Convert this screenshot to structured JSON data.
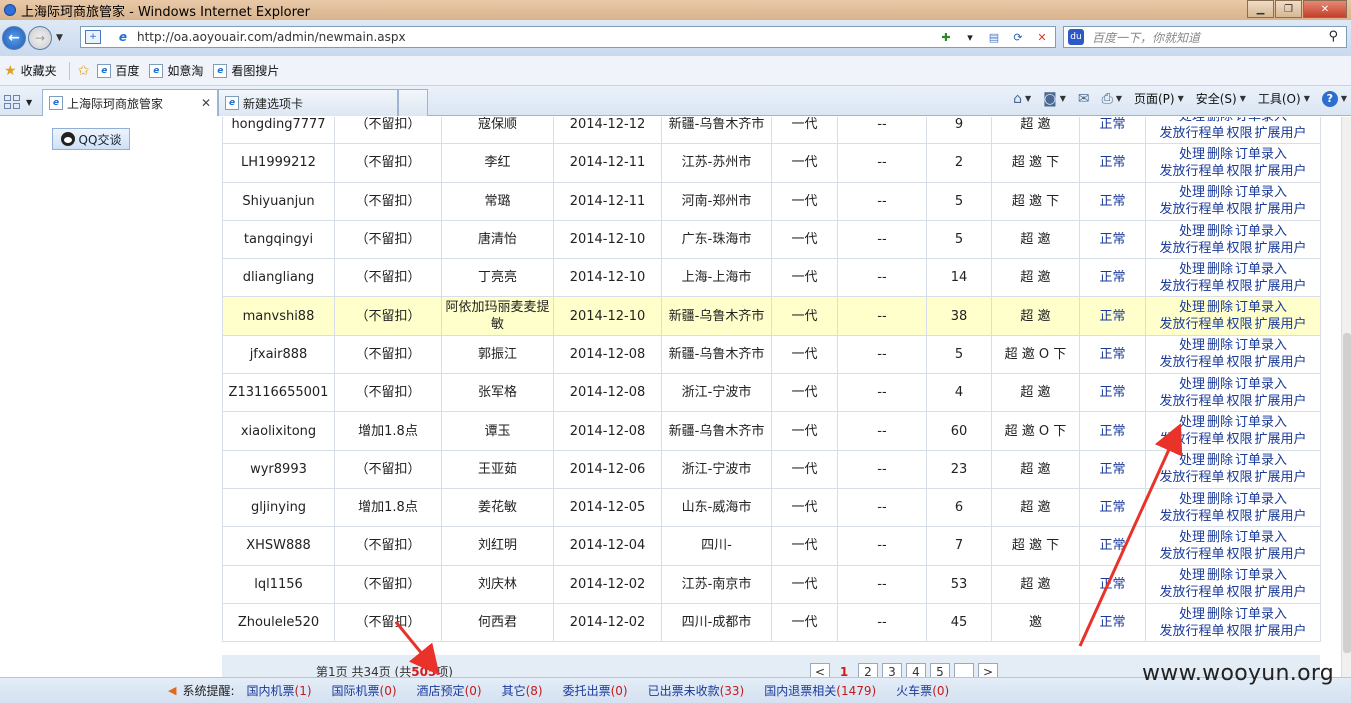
{
  "window": {
    "title": "上海际珂商旅管家 - Windows Internet Explorer"
  },
  "address": {
    "url": "http://oa.aoyouair.com/admin/newmain.aspx",
    "search_placeholder": "百度一下，你就知道"
  },
  "favorites": {
    "label": "收藏夹",
    "items": [
      "百度",
      "如意淘",
      "看图搜片"
    ]
  },
  "tabs": [
    {
      "label": "上海际珂商旅管家"
    },
    {
      "label": "新建选项卡"
    }
  ],
  "commands": {
    "page": "页面(P)",
    "safety": "安全(S)",
    "tools": "工具(O)"
  },
  "sidebar": {
    "qq_label": "QQ交谈"
  },
  "table": {
    "rows": [
      [
        "hongding7777",
        "（不留扣）",
        "寇保顺",
        "2014-12-12",
        "新疆-乌鲁木齐市",
        "一代",
        "--",
        "9",
        "超 邀",
        "正常"
      ],
      [
        "LH1999212",
        "（不留扣）",
        "李红",
        "2014-12-11",
        "江苏-苏州市",
        "一代",
        "--",
        "2",
        "超 邀 下",
        "正常"
      ],
      [
        "Shiyuanjun",
        "（不留扣）",
        "常璐",
        "2014-12-11",
        "河南-郑州市",
        "一代",
        "--",
        "5",
        "超 邀 下",
        "正常"
      ],
      [
        "tangqingyi",
        "（不留扣）",
        "唐清怡",
        "2014-12-10",
        "广东-珠海市",
        "一代",
        "--",
        "5",
        "超 邀",
        "正常"
      ],
      [
        "dliangliang",
        "（不留扣）",
        "丁亮亮",
        "2014-12-10",
        "上海-上海市",
        "一代",
        "--",
        "14",
        "超 邀",
        "正常"
      ],
      [
        "manvshi88",
        "（不留扣）",
        "阿依加玛丽麦麦提敏",
        "2014-12-10",
        "新疆-乌鲁木齐市",
        "一代",
        "--",
        "38",
        "超 邀",
        "正常"
      ],
      [
        "jfxair888",
        "（不留扣）",
        "郭振江",
        "2014-12-08",
        "新疆-乌鲁木齐市",
        "一代",
        "--",
        "5",
        "超 邀 O 下",
        "正常"
      ],
      [
        "Z13116655001",
        "（不留扣）",
        "张军格",
        "2014-12-08",
        "浙江-宁波市",
        "一代",
        "--",
        "4",
        "超 邀",
        "正常"
      ],
      [
        "xiaolixitong",
        "增加1.8点",
        "谭玉",
        "2014-12-08",
        "新疆-乌鲁木齐市",
        "一代",
        "--",
        "60",
        "超 邀 O 下",
        "正常"
      ],
      [
        "wyr8993",
        "（不留扣）",
        "王亚茹",
        "2014-12-06",
        "浙江-宁波市",
        "一代",
        "--",
        "23",
        "超 邀",
        "正常"
      ],
      [
        "gljinying",
        "增加1.8点",
        "姜花敏",
        "2014-12-05",
        "山东-威海市",
        "一代",
        "--",
        "6",
        "超 邀",
        "正常"
      ],
      [
        "XHSW888",
        "（不留扣）",
        "刘红明",
        "2014-12-04",
        "四川-",
        "一代",
        "--",
        "7",
        "超 邀 下",
        "正常"
      ],
      [
        "lql1156",
        "（不留扣）",
        "刘庆林",
        "2014-12-02",
        "江苏-南京市",
        "一代",
        "--",
        "53",
        "超 邀",
        "正常"
      ],
      [
        "Zhoulele520",
        "（不留扣）",
        "何西君",
        "2014-12-02",
        "四川-成都市",
        "一代",
        "--",
        "45",
        "邀",
        "正常"
      ]
    ],
    "ops_line1": [
      "处理",
      "删除",
      "订单录入"
    ],
    "ops_line2": [
      "发放行程单",
      "权限",
      "扩展用户"
    ]
  },
  "pager": {
    "prefix": "第1页 共34页 (共",
    "total": "505",
    "suffix": "项)",
    "pages": [
      "<",
      "1",
      "2",
      "3",
      "4",
      "5",
      "",
      ">"
    ]
  },
  "status": {
    "label": "系统提醒:",
    "items": [
      {
        "name": "国内机票",
        "count": "(1)"
      },
      {
        "name": "国际机票",
        "count": "(0)"
      },
      {
        "name": "酒店预定",
        "count": "(0)"
      },
      {
        "name": "其它",
        "count": "(8)"
      },
      {
        "name": "委托出票",
        "count": "(0)"
      },
      {
        "name": "已出票未收款",
        "count": "(33)"
      },
      {
        "name": "国内退票相关",
        "count": "(1479)"
      },
      {
        "name": "火车票",
        "count": "(0)"
      }
    ]
  },
  "watermark": "www.wooyun.org",
  "colors": {
    "annotation_arrow": "#e8322a",
    "link": "#1a3a9a",
    "highlight_row": "#ffffcc"
  }
}
